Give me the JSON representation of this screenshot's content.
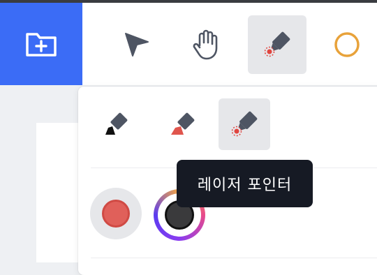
{
  "toolbar": {
    "tools": [
      {
        "icon": "folder-plus-icon"
      },
      {
        "icon": "pointer-arrow-icon"
      },
      {
        "icon": "hand-icon"
      },
      {
        "icon": "laser-pointer-icon",
        "active": true
      },
      {
        "icon": "circle-icon"
      }
    ]
  },
  "pen_panel": {
    "pen_types": [
      {
        "icon": "marker-pen-icon"
      },
      {
        "icon": "highlighter-icon"
      },
      {
        "icon": "laser-pointer-icon",
        "active": true
      }
    ],
    "colors": [
      {
        "name": "red",
        "fill": "#e0605a",
        "selected": true
      },
      {
        "name": "black",
        "fill": "#3a3a3c"
      }
    ]
  },
  "tooltip": {
    "text": "레이저 포인터"
  },
  "colors": {
    "accent": "#3b6cf6",
    "tooltip_bg": "#161a24",
    "active_bg": "#e6e7ea",
    "circle_tool": "#e8a23a"
  }
}
